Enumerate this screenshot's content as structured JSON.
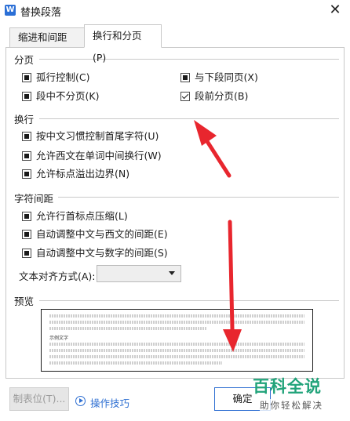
{
  "window": {
    "title": "替换段落",
    "app_icon_letter": "W",
    "close_glyph": "✕"
  },
  "tabs": [
    {
      "label": "缩进和间距(I)",
      "active": false
    },
    {
      "label": "换行和分页(P)",
      "active": true
    }
  ],
  "pagination": {
    "title": "分页",
    "options": [
      {
        "label": "孤行控制(C)",
        "state": "indeterminate"
      },
      {
        "label": "与下段同页(X)",
        "state": "indeterminate"
      },
      {
        "label": "段中不分页(K)",
        "state": "indeterminate"
      },
      {
        "label": "段前分页(B)",
        "state": "checked"
      }
    ]
  },
  "line_break": {
    "title": "换行",
    "options": [
      {
        "label": "按中文习惯控制首尾字符(U)",
        "state": "indeterminate"
      },
      {
        "label": "允许西文在单词中间换行(W)",
        "state": "indeterminate"
      },
      {
        "label": "允许标点溢出边界(N)",
        "state": "indeterminate"
      }
    ]
  },
  "char_spacing": {
    "title": "字符间距",
    "options": [
      {
        "label": "允许行首标点压缩(L)",
        "state": "indeterminate"
      },
      {
        "label": "自动调整中文与西文的间距(E)",
        "state": "indeterminate"
      },
      {
        "label": "自动调整中文与数字的间距(S)",
        "state": "indeterminate"
      }
    ],
    "text_alignment": {
      "label": "文本对齐方式(A):",
      "value": ""
    }
  },
  "preview": {
    "title": "预览",
    "sample_text": "示例文字"
  },
  "buttons": {
    "tabs": "制表位(T)...",
    "tips": "操作技巧",
    "ok": "确定"
  },
  "watermark": {
    "main": "百科全说",
    "sub": "助你轻松解决"
  },
  "colors": {
    "accent": "#2e6fd2",
    "arrow": "#e8262e",
    "watermark": "#21a37a"
  }
}
